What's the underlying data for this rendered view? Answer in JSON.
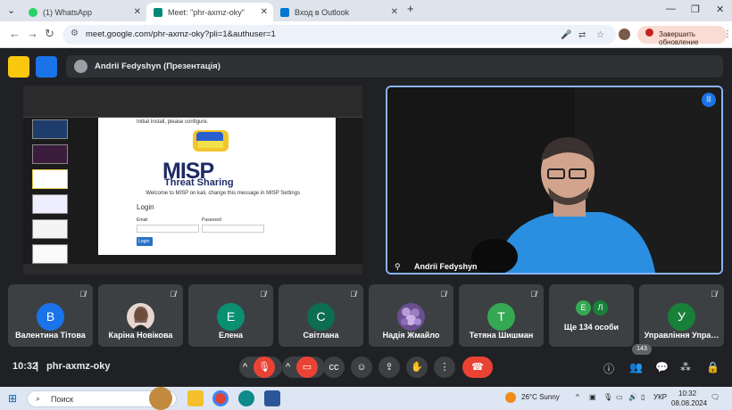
{
  "browser": {
    "tabs": [
      {
        "title": "(1) WhatsApp",
        "color": "#25d366"
      },
      {
        "title": "Meet: \"phr-axmz-oky\"",
        "color": "#00897b"
      },
      {
        "title": "Вход в Outlook",
        "color": "#0078d4"
      }
    ],
    "url": "meet.google.com/phr-axmz-oky?pli=1&authuser=1",
    "update_label": "Завершить обновление",
    "new_tab": "+"
  },
  "meet": {
    "presentation_label": "Andrii Fedyshyn (Презентація)",
    "speaker_name": "Andrii Fedyshyn",
    "meeting_code": "phr-axmz-oky",
    "time": "10:32",
    "participants_count": "143",
    "more_label": "Ще 134 особи",
    "more_avatars": [
      "Е",
      "Л"
    ],
    "tiles": [
      {
        "name": "Валентина Тітова",
        "initial": "В",
        "color": "#1a73e8"
      },
      {
        "name": "Каріна Новікова",
        "initial": "",
        "color": "#8e6a5a"
      },
      {
        "name": "Елена",
        "initial": "Е",
        "color": "#0b8f73"
      },
      {
        "name": "Світлана",
        "initial": "С",
        "color": "#0b6e4f"
      },
      {
        "name": "Надія Жмайло",
        "initial": "",
        "color": "#7b5ea7"
      },
      {
        "name": "Тетяна Шишман",
        "initial": "Т",
        "color": "#34a853"
      },
      {
        "name": "Управління Упра…",
        "initial": "У",
        "color": "#188038"
      }
    ]
  },
  "slide": {
    "initial_text": "Initial Install, please configure.",
    "logo_text": "MISP",
    "logo_sub": "Threat Sharing",
    "welcome": "Welcome to MISP on kali, change this message in MISP Settings",
    "login_title": "Login",
    "email_label": "Email",
    "password_label": "Password",
    "login_button": "Login"
  },
  "taskbar": {
    "search_placeholder": "Поиск",
    "weather": "26°C  Sunny",
    "lang": "УКР",
    "clock_time": "10:32",
    "clock_date": "08.08.2024"
  }
}
